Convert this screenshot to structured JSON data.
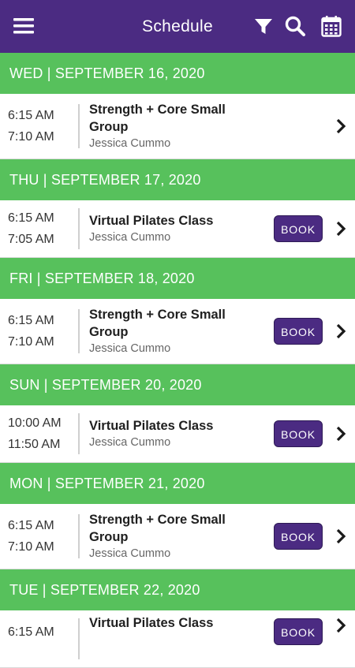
{
  "header": {
    "title": "Schedule",
    "icons": [
      "menu-icon",
      "filter-icon",
      "search-icon",
      "calendar-icon"
    ],
    "background": "#4b2b82"
  },
  "colors": {
    "day_header": "#57c15c",
    "book_button": "#4b2b82"
  },
  "days": [
    {
      "label": "WED | SEPTEMBER 16, 2020",
      "session": {
        "start": "6:15 AM",
        "end": "7:10 AM",
        "name": "Strength + Core Small Group",
        "instructor": "Jessica Cummo",
        "book": ""
      }
    },
    {
      "label": "THU | SEPTEMBER 17, 2020",
      "session": {
        "start": "6:15 AM",
        "end": "7:05 AM",
        "name": "Virtual Pilates Class",
        "instructor": "Jessica Cummo",
        "book": "BOOK"
      }
    },
    {
      "label": "FRI | SEPTEMBER 18, 2020",
      "session": {
        "start": "6:15 AM",
        "end": "7:10 AM",
        "name": "Strength + Core Small Group",
        "instructor": "Jessica Cummo",
        "book": "BOOK"
      }
    },
    {
      "label": "SUN | SEPTEMBER 20, 2020",
      "session": {
        "start": "10:00 AM",
        "end": "11:50 AM",
        "name": "Virtual Pilates Class",
        "instructor": "Jessica Cummo",
        "book": "BOOK"
      }
    },
    {
      "label": "MON | SEPTEMBER 21, 2020",
      "session": {
        "start": "6:15 AM",
        "end": "7:10 AM",
        "name": "Strength + Core Small Group",
        "instructor": "Jessica Cummo",
        "book": "BOOK"
      }
    },
    {
      "label": "TUE | SEPTEMBER 22, 2020",
      "session": {
        "start": "6:15 AM",
        "end": "",
        "name": "Virtual Pilates Class",
        "instructor": "",
        "book": "BOOK"
      }
    }
  ]
}
